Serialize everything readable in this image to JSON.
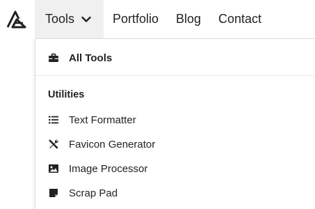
{
  "nav": {
    "tools_label": "Tools",
    "portfolio_label": "Portfolio",
    "blog_label": "Blog",
    "contact_label": "Contact"
  },
  "dropdown": {
    "all_tools_label": "All Tools",
    "section_heading": "Utilities",
    "items": [
      {
        "label": "Text Formatter",
        "icon": "list-icon"
      },
      {
        "label": "Favicon Generator",
        "icon": "tools-icon"
      },
      {
        "label": "Image Processor",
        "icon": "image-icon"
      },
      {
        "label": "Scrap Pad",
        "icon": "sticky-note-icon"
      }
    ]
  },
  "colors": {
    "active_tab_bg": "#f0f0f0",
    "text": "#222222",
    "border": "#dcdcdc"
  }
}
